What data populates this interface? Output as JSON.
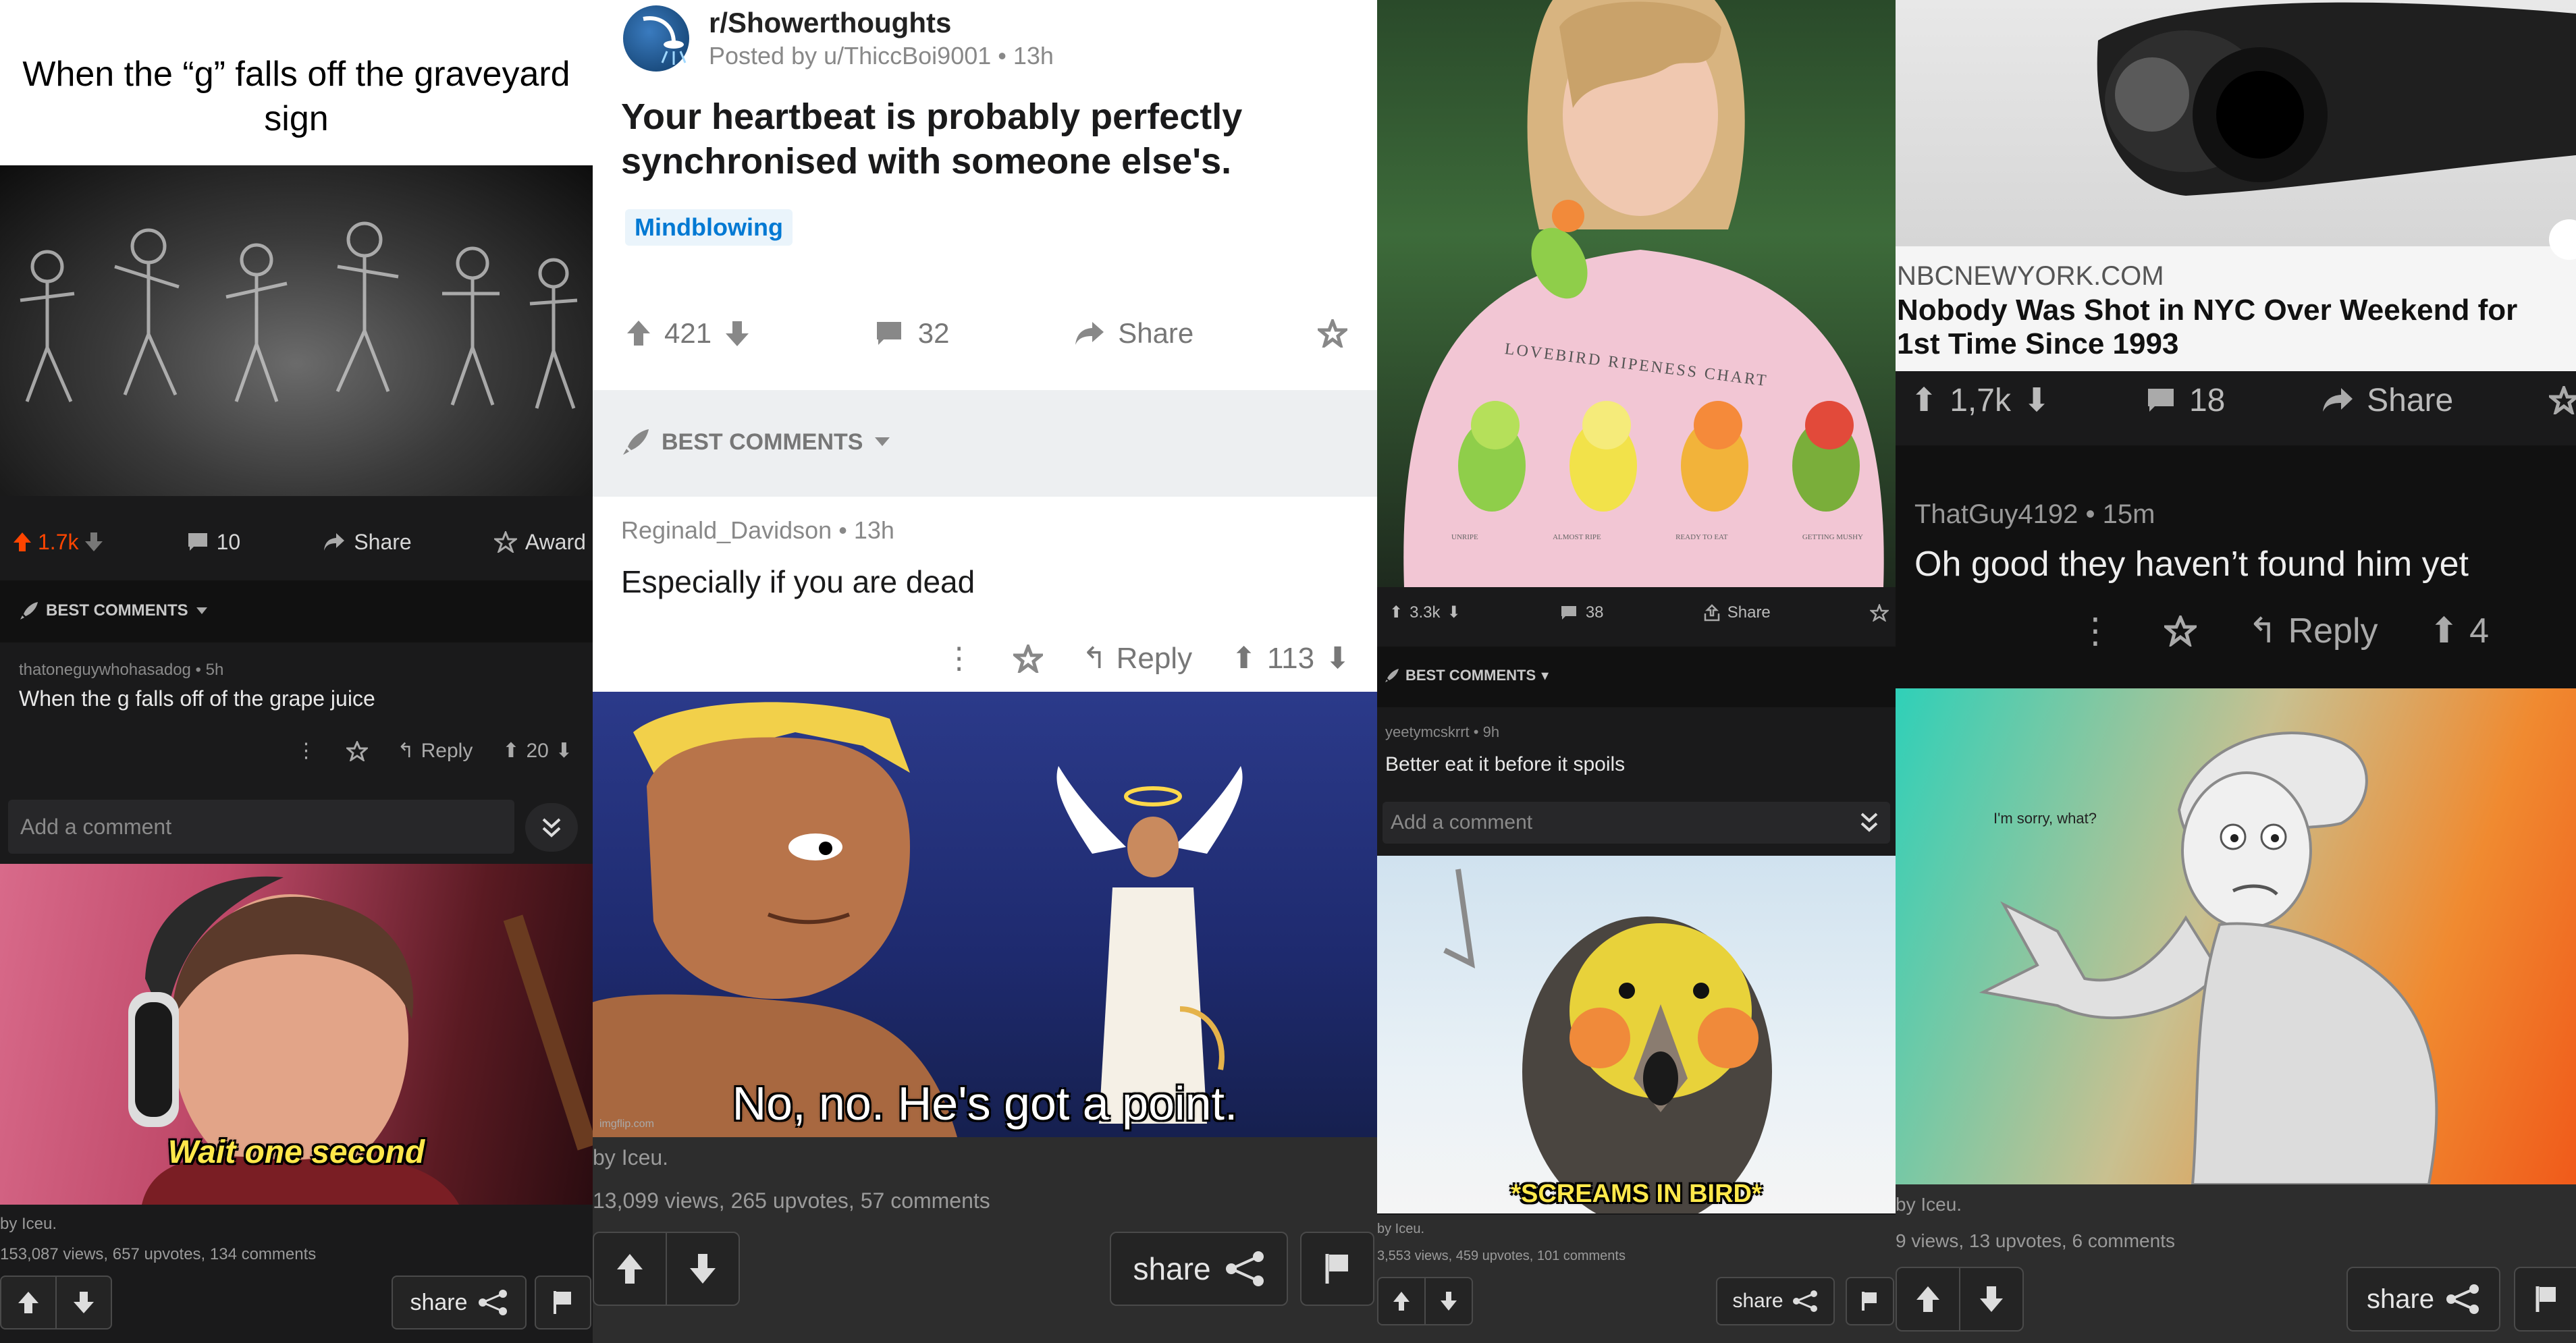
{
  "panel1": {
    "title_caption": "When the “g” falls off the graveyard sign",
    "actions": {
      "upvotes": "1.7k",
      "comments": "10",
      "share": "Share",
      "award": "Award"
    },
    "best_comments": "BEST COMMENTS",
    "comment": {
      "user": "thatoneguywhohasadog",
      "time": "5h",
      "text": "When the g falls off of the grape juice",
      "reply": "Reply",
      "votes": "20"
    },
    "add_comment_placeholder": "Add a comment",
    "image_caption": "Wait one second",
    "footer": {
      "by": "by Iceu.",
      "stats": "153,087 views, 657 upvotes, 134 comments",
      "share": "share"
    }
  },
  "panel2": {
    "subreddit": "r/Showerthoughts",
    "posted_by": "Posted by u/ThiccBoi9001",
    "posted_time": "13h",
    "title": "Your heartbeat is probably perfectly synchronised with someone else's.",
    "flair": "Mindblowing",
    "actions": {
      "upvotes": "421",
      "comments": "32",
      "share": "Share"
    },
    "best_comments": "BEST COMMENTS",
    "comment": {
      "user": "Reginald_Davidson",
      "time": "13h",
      "text": "Especially if you are dead",
      "reply": "Reply",
      "votes": "113"
    },
    "image_caption": "No, no. He's got a point.",
    "watermark": "imgflip.com",
    "footer": {
      "by": "by Iceu.",
      "stats": "13,099 views, 265 upvotes, 57 comments",
      "share": "share"
    }
  },
  "panel3": {
    "shirt_text": "LOVEBIRD RIPENESS CHART",
    "bird_labels": [
      "UNRIPE",
      "ALMOST RIPE",
      "READY TO EAT",
      "GETTING MUSHY"
    ],
    "actions": {
      "upvotes": "3.3k",
      "comments": "38",
      "share": "Share"
    },
    "best_comments": "BEST COMMENTS",
    "comment": {
      "user": "yeetymcskrrt",
      "time": "9h",
      "text": "Better eat it before it spoils"
    },
    "add_comment_placeholder": "Add a comment",
    "image_caption": "*SCREAMS IN BIRD*",
    "footer": {
      "by": "by Iceu.",
      "stats": "3,553 views, 459 upvotes, 101 comments",
      "share": "share"
    }
  },
  "panel4": {
    "source": "NBCNEWYORK.COM",
    "headline": "Nobody Was Shot in NYC Over Weekend for 1st Time Since 1993",
    "actions": {
      "upvotes": "1,7k",
      "comments": "18",
      "share": "Share"
    },
    "comment": {
      "user": "ThatGuy4192",
      "time": "15m",
      "text": "Oh good they haven’t found him yet",
      "reply": "Reply",
      "votes": "4"
    },
    "image_caption": "I'm sorry, what?",
    "footer": {
      "by": "by Iceu.",
      "stats": "9 views, 13 upvotes, 6 comments",
      "share": "share"
    }
  },
  "colors": {
    "reddit_orange": "#ff4500",
    "dark_bg": "#1a1a1b",
    "flair_blue": "#0079d3"
  }
}
